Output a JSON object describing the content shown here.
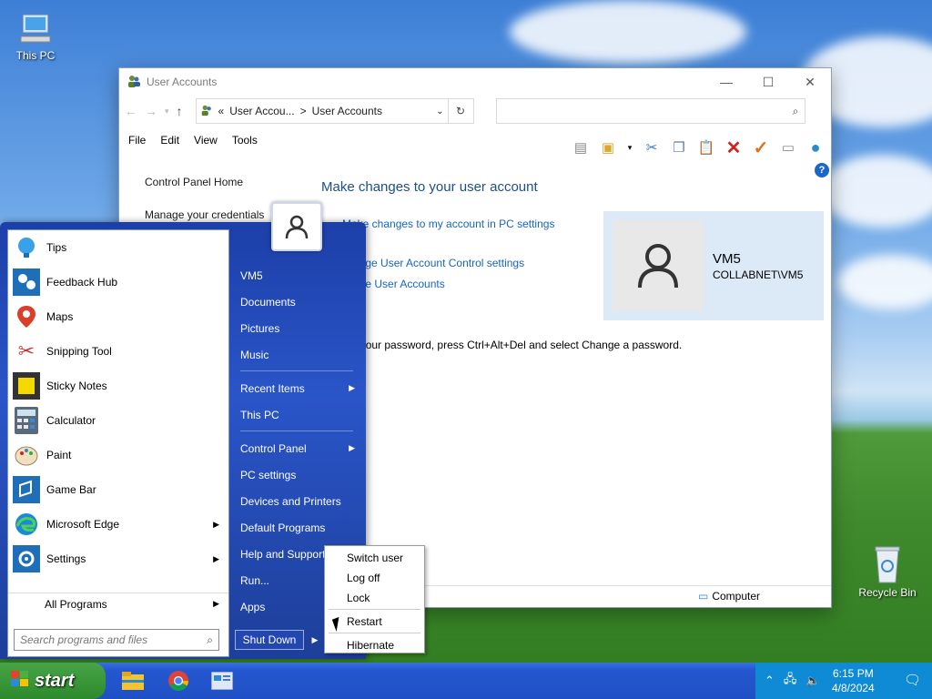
{
  "desktop": {
    "this_pc_label": "This PC",
    "recycle_bin_label": "Recycle Bin"
  },
  "window": {
    "title": "User Accounts",
    "address": {
      "part1": "User Accou...",
      "sep": ">",
      "part2": "User Accounts",
      "prefix": "«"
    },
    "menu": [
      "File",
      "Edit",
      "View",
      "Tools"
    ],
    "left_nav": {
      "home": "Control Panel Home",
      "credentials": "Manage your credentials"
    },
    "heading": "Make changes to your user account",
    "links": {
      "pc_settings": "Make changes to my account in PC settings",
      "uac": "ange User Account Control settings",
      "manage": "age User Accounts"
    },
    "account": {
      "name": "VM5",
      "domain": "COLLABNET\\VM5"
    },
    "password_text": "change your password, press Ctrl+Alt+Del and select Change a password.",
    "status": {
      "computer": "Computer"
    }
  },
  "start_menu": {
    "apps": [
      {
        "label": "Tips",
        "icon": "tips-icon"
      },
      {
        "label": "Feedback Hub",
        "icon": "feedback-hub-icon"
      },
      {
        "label": "Maps",
        "icon": "maps-icon"
      },
      {
        "label": "Snipping Tool",
        "icon": "snipping-tool-icon"
      },
      {
        "label": "Sticky Notes",
        "icon": "sticky-notes-icon"
      },
      {
        "label": "Calculator",
        "icon": "calculator-icon"
      },
      {
        "label": "Paint",
        "icon": "paint-icon"
      },
      {
        "label": "Game Bar",
        "icon": "game-bar-icon"
      },
      {
        "label": "Microsoft Edge",
        "icon": "edge-icon"
      },
      {
        "label": "Settings",
        "icon": "settings-icon"
      }
    ],
    "all_programs": "All Programs",
    "search_placeholder": "Search programs and files",
    "right": {
      "vm5": "VM5",
      "documents": "Documents",
      "pictures": "Pictures",
      "music": "Music",
      "recent": "Recent Items",
      "this_pc": "This PC",
      "control_panel": "Control Panel",
      "pc_settings": "PC settings",
      "devices": "Devices and Printers",
      "defaults": "Default Programs",
      "help": "Help and Support",
      "run": "Run...",
      "apps": "Apps"
    },
    "shutdown": "Shut Down"
  },
  "shutdown_menu": {
    "switch_user": "Switch user",
    "log_off": "Log off",
    "lock": "Lock",
    "restart": "Restart",
    "hibernate": "Hibernate"
  },
  "taskbar": {
    "start": "start",
    "time": "6:15 PM",
    "date": "4/8/2024"
  }
}
